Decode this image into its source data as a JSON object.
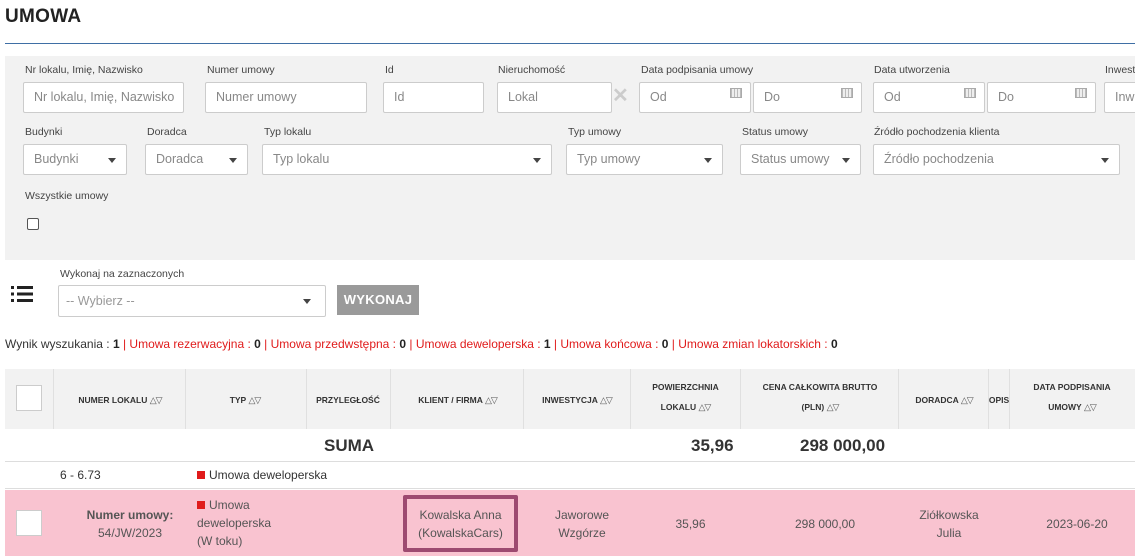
{
  "page": {
    "title": "UMOWA"
  },
  "filters": {
    "lot_label": "Nr lokalu, Imię, Nazwisko",
    "lot_placeholder": "Nr lokalu, Imię, Nazwisko",
    "contract_no_label": "Numer umowy",
    "contract_no_placeholder": "Numer umowy",
    "id_label": "Id",
    "id_placeholder": "Id",
    "property_label": "Nieruchomość",
    "property_placeholder": "Lokal",
    "signed_label": "Data podpisania umowy",
    "created_label": "Data utworzenia",
    "from_placeholder": "Od",
    "to_placeholder": "Do",
    "investment_label": "Inwest",
    "investment_placeholder": "Inw",
    "buildings_label": "Budynki",
    "buildings_value": "Budynki",
    "advisor_label": "Doradca",
    "advisor_value": "Doradca",
    "lot_type_label": "Typ lokalu",
    "lot_type_value": "Typ lokalu",
    "contract_type_label": "Typ umowy",
    "contract_type_value": "Typ umowy",
    "status_label": "Status umowy",
    "status_value": "Status umowy",
    "source_label": "Źródło pochodzenia klienta",
    "source_value": "Źródło pochodzenia",
    "all_label": "Wszystkie umowy"
  },
  "bulk": {
    "label": "Wykonaj na zaznaczonych",
    "select_value": "-- Wybierz --",
    "run_label": "WYKONAJ"
  },
  "summary": {
    "results_label": "Wynik wyszukania : ",
    "results_count": "1",
    "sep": " | ",
    "reservation_label": "Umowa rezerwacyjna : ",
    "reservation_count": "0",
    "preliminary_label": "Umowa przedwstępna : ",
    "preliminary_count": "0",
    "developer_label": "Umowa deweloperska : ",
    "developer_count": "1",
    "final_label": "Umowa końcowa : ",
    "final_count": "0",
    "tenant_label": "Umowa zmian lokatorskich : ",
    "tenant_count": "0"
  },
  "table": {
    "columns": {
      "lot_no": "NUMER LOKALU",
      "type": "TYP",
      "adjacency": "PRZYLEGŁOŚĆ",
      "client": "KLIENT / FIRMA",
      "investment": "INWESTYCJA",
      "area_1": "POWIERZCHNIA",
      "area_2": "LOKALU",
      "price_1": "CENA CAŁKOWITA BRUTTO",
      "price_2": "(PLN)",
      "advisor": "DORADCA",
      "desc": "OPIS",
      "date_1": "DATA PODPISANIA",
      "date_2": "UMOWY"
    },
    "sort_icon": "△▽",
    "totals": {
      "label": "SUMA",
      "area": "35,96",
      "price": "298 000,00"
    },
    "group": {
      "lot_range": "6 - 6.73",
      "type": "Umowa deweloperska"
    },
    "row": {
      "contract_label": "Numer umowy:",
      "contract_no": "54/JW/2023",
      "type_1": "Umowa",
      "type_2": "deweloperska",
      "type_3": "(W toku)",
      "client_1": "Kowalska Anna",
      "client_2": "(KowalskaCars)",
      "investment_1": "Jaworowe",
      "investment_2": "Wzgórze",
      "area": "35,96",
      "price": "298 000,00",
      "advisor_1": "Ziółkowska",
      "advisor_2": "Julia",
      "date": "2023-06-20"
    }
  },
  "colors": {
    "accent_red": "#e01b1b",
    "row_highlight": "#f9c3d0",
    "selection_border": "#9d4a70"
  }
}
